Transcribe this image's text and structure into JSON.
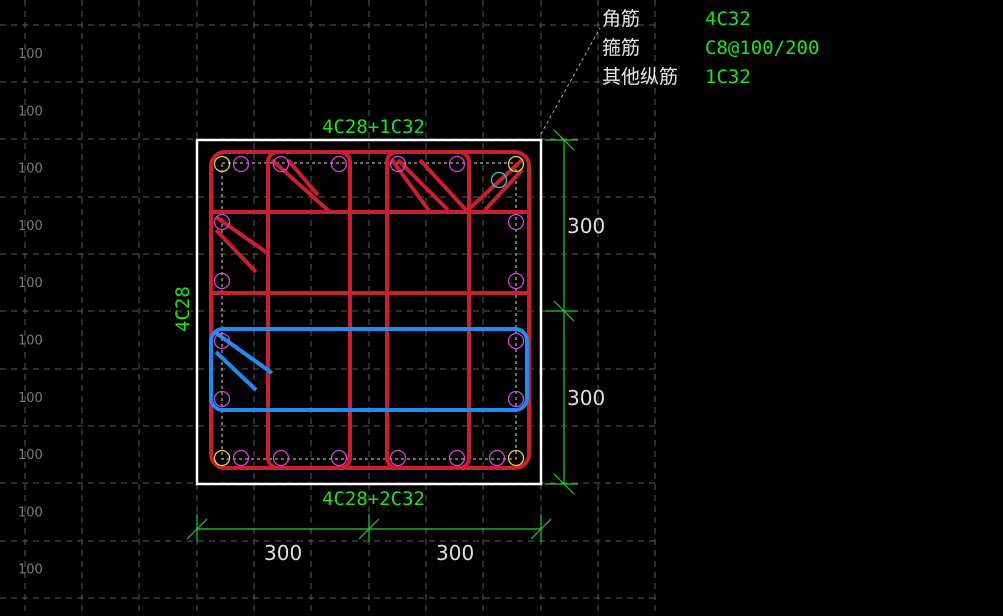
{
  "grid": {
    "row_label": "100",
    "row_count": 10
  },
  "section": {
    "top_rebar": "4C28+1C32",
    "bottom_rebar": "4C28+2C32",
    "side_rebar": "4C28"
  },
  "dimensions": {
    "right_upper": "300",
    "right_lower": "300",
    "bottom_left": "300",
    "bottom_right": "300"
  },
  "legend": {
    "corner_label": "角筋",
    "corner_value": "4C32",
    "stirrup_label": "箍筋",
    "stirrup_value": "C8@100/200",
    "other_label": "其他纵筋",
    "other_value": "1C32"
  },
  "colors": {
    "background": "#000000",
    "stirrup": "#c8202c",
    "tie_highlight": "#1e8cf0",
    "dimension": "#20d020",
    "bar_circle": "#e040e0",
    "corner_bar": "#e8d84a"
  }
}
